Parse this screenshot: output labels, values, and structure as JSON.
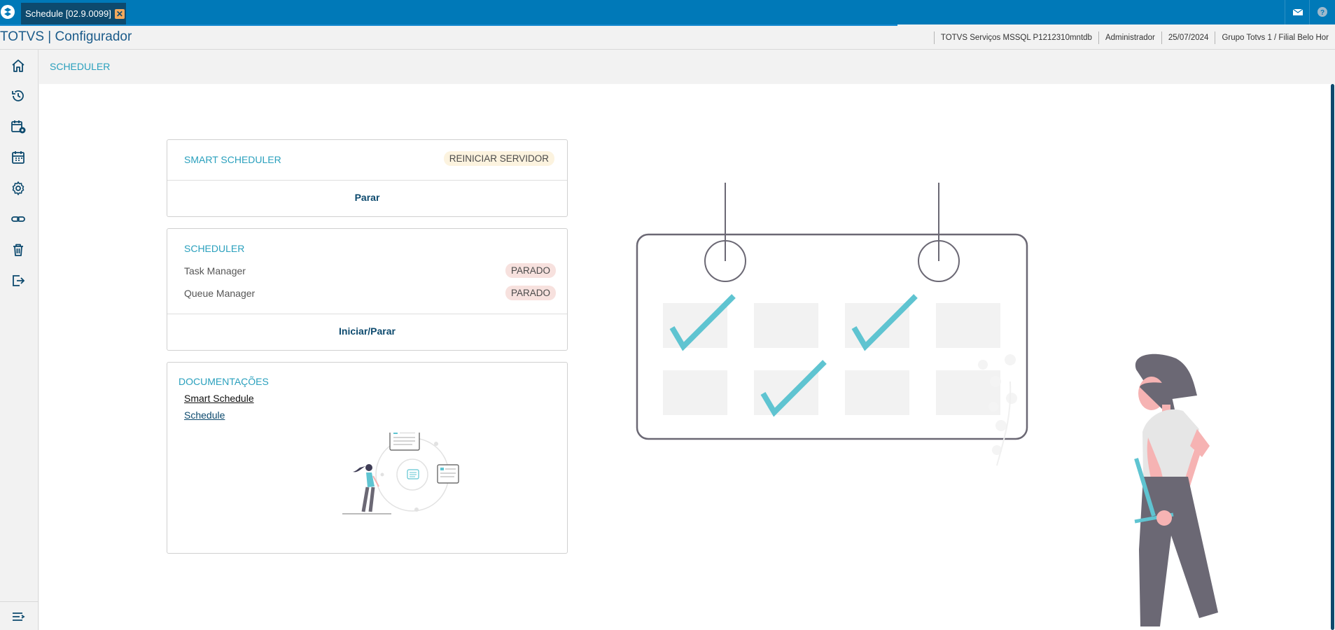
{
  "titlebar": {
    "tab_label": "Schedule [02.9.0099]",
    "close_glyph": "✕"
  },
  "header": {
    "app_title": "TOTVS | Configurador",
    "environment": "TOTVS Serviços MSSQL P1212310mntdb",
    "user": "Administrador",
    "date": "25/07/2024",
    "branch": "Grupo Totvs 1 / Filial Belo Hor"
  },
  "sidebar": {
    "items": [
      {
        "icon": "home-icon"
      },
      {
        "icon": "history-icon"
      },
      {
        "icon": "calendar-settings-icon"
      },
      {
        "icon": "calendar-icon"
      },
      {
        "icon": "gear-icon"
      },
      {
        "icon": "link-icon"
      },
      {
        "icon": "trash-icon"
      },
      {
        "icon": "logout-icon"
      }
    ],
    "bottom_icon": "menu-collapse-icon"
  },
  "breadcrumb": {
    "title": "SCHEDULER"
  },
  "smart_scheduler": {
    "title": "SMART SCHEDULER",
    "status": "REINICIAR SERVIDOR",
    "action": "Parar"
  },
  "scheduler": {
    "title": "SCHEDULER",
    "rows": [
      {
        "label": "Task Manager",
        "status": "PARADO"
      },
      {
        "label": "Queue Manager",
        "status": "PARADO"
      }
    ],
    "action": "Iniciar/Parar"
  },
  "docs": {
    "title": "DOCUMENTAÇÕES",
    "links": [
      "Smart Schedule",
      "Schedule"
    ]
  },
  "colors": {
    "accent": "#2aa0bd",
    "primary": "#0079b8",
    "dark_blue": "#0d4a6e",
    "check": "#5fc4d1",
    "skin": "#f6b3b3",
    "figure_dark": "#6b6874"
  }
}
